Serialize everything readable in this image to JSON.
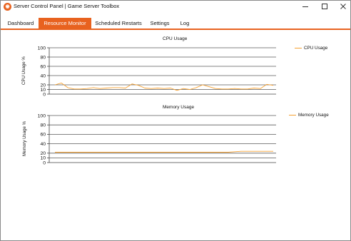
{
  "window": {
    "title": "Server Control Panel | Game Server Toolbox",
    "icon": "app-logo-icon",
    "accent": "#e8621f",
    "controls": [
      "minimize-icon",
      "maximize-icon",
      "close-icon"
    ]
  },
  "tabs": [
    {
      "label": "Dashboard",
      "active": false
    },
    {
      "label": "Resource Monitor",
      "active": true
    },
    {
      "label": "Scheduled Restarts",
      "active": false
    },
    {
      "label": "Settings",
      "active": false
    },
    {
      "label": "Log",
      "active": false
    }
  ],
  "chart_data": [
    {
      "type": "line",
      "title": "CPU Usage",
      "ylabel": "CPU Usage %",
      "xlabel": "",
      "ylim": [
        0,
        100
      ],
      "yticks": [
        0,
        10,
        20,
        40,
        60,
        80,
        100
      ],
      "grid": true,
      "legend": "top-right",
      "series": [
        {
          "name": "CPU Usage",
          "color": "#f5a030",
          "values": [
            20,
            24,
            14,
            11,
            11,
            12,
            14,
            12,
            13,
            14,
            14,
            13,
            22,
            19,
            13,
            12,
            13,
            12,
            13,
            8,
            12,
            10,
            14,
            20,
            16,
            12,
            11,
            11,
            12,
            11,
            11,
            13,
            12,
            21,
            19
          ]
        }
      ]
    },
    {
      "type": "line",
      "title": "Memory Usage",
      "ylabel": "Memory Usage %",
      "xlabel": "",
      "ylim": [
        0,
        100
      ],
      "yticks": [
        0,
        10,
        20,
        40,
        60,
        80,
        100
      ],
      "grid": true,
      "legend": "top-right",
      "series": [
        {
          "name": "Memory Usage",
          "color": "#f5a030",
          "values": [
            22,
            22,
            22,
            22,
            22,
            22,
            22,
            22,
            22,
            22,
            22,
            22,
            22,
            22,
            22,
            22,
            22,
            22,
            22,
            22,
            22,
            22,
            22,
            22,
            22,
            22,
            22,
            22,
            23,
            24,
            24,
            24,
            24,
            24,
            24
          ]
        }
      ]
    }
  ]
}
